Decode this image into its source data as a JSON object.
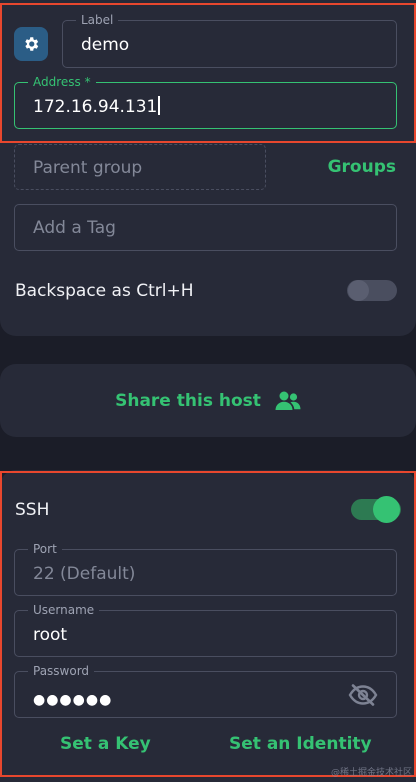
{
  "host": {
    "label": {
      "legend": "Label",
      "value": "demo"
    },
    "address": {
      "legend": "Address *",
      "value": "172.16.94.131"
    },
    "parent_group": {
      "placeholder": "Parent group"
    },
    "groups_link": "Groups",
    "tag": {
      "placeholder": "Add a Tag"
    },
    "backspace": {
      "label": "Backspace as Ctrl+H",
      "enabled": false
    }
  },
  "share": {
    "label": "Share this host"
  },
  "ssh": {
    "title": "SSH",
    "enabled": true,
    "port": {
      "legend": "Port",
      "value": "22 (Default)"
    },
    "username": {
      "legend": "Username",
      "value": "root"
    },
    "password": {
      "legend": "Password",
      "value": "●●●●●●"
    },
    "set_key": "Set a Key",
    "set_identity": "Set an Identity"
  },
  "watermark": "@稀土掘金技术社区",
  "colors": {
    "accent": "#35c273",
    "annotation": "#e8472e",
    "card": "#272a38",
    "background": "#1b1d28"
  },
  "icons": {
    "settings": "gear-icon",
    "share": "users-icon",
    "password_visibility": "eye-off-icon"
  }
}
